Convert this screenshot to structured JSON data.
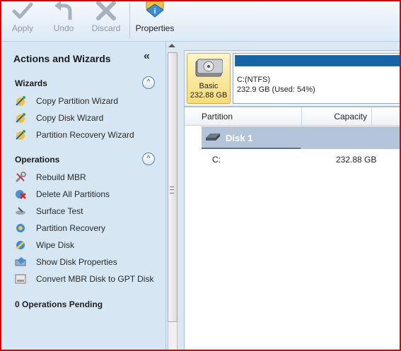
{
  "toolbar": {
    "apply_label": "Apply",
    "undo_label": "Undo",
    "discard_label": "Discard",
    "properties_label": "Properties"
  },
  "sidebar": {
    "title": "Actions and Wizards",
    "collapse_glyph": "«",
    "wizards": {
      "heading": "Wizards",
      "toggle_glyph": "^",
      "items": [
        {
          "label": "Copy Partition Wizard",
          "icon": "wizard-wand-icon"
        },
        {
          "label": "Copy Disk Wizard",
          "icon": "wizard-wand-icon"
        },
        {
          "label": "Partition Recovery Wizard",
          "icon": "wizard-wand-icon"
        }
      ]
    },
    "operations": {
      "heading": "Operations",
      "toggle_glyph": "^",
      "items": [
        {
          "label": "Rebuild MBR",
          "icon": "wrench-icon"
        },
        {
          "label": "Delete All Partitions",
          "icon": "delete-partitions-icon"
        },
        {
          "label": "Surface Test",
          "icon": "surface-test-icon"
        },
        {
          "label": "Partition Recovery",
          "icon": "partition-recovery-icon"
        },
        {
          "label": "Wipe Disk",
          "icon": "wipe-disk-icon"
        },
        {
          "label": "Show Disk Properties",
          "icon": "disk-properties-icon"
        },
        {
          "label": "Convert MBR Disk to GPT Disk",
          "icon": "gpt-convert-icon"
        }
      ]
    },
    "pending": "0 Operations Pending"
  },
  "disk_map": {
    "disk_type": "Basic",
    "disk_size": "232.88 GB",
    "partition_name": "C:(NTFS)",
    "partition_info": "232.9 GB (Used: 54%)",
    "used_percent": 54
  },
  "table": {
    "columns": [
      "Partition",
      "Capacity"
    ],
    "disk_label": "Disk 1",
    "rows": [
      {
        "partition": "C:",
        "capacity": "232.88 GB"
      }
    ]
  },
  "colors": {
    "accent_border": "#e10000",
    "partition_bar": "#1465a8",
    "sidebar_bg": "#d6e6f2"
  }
}
